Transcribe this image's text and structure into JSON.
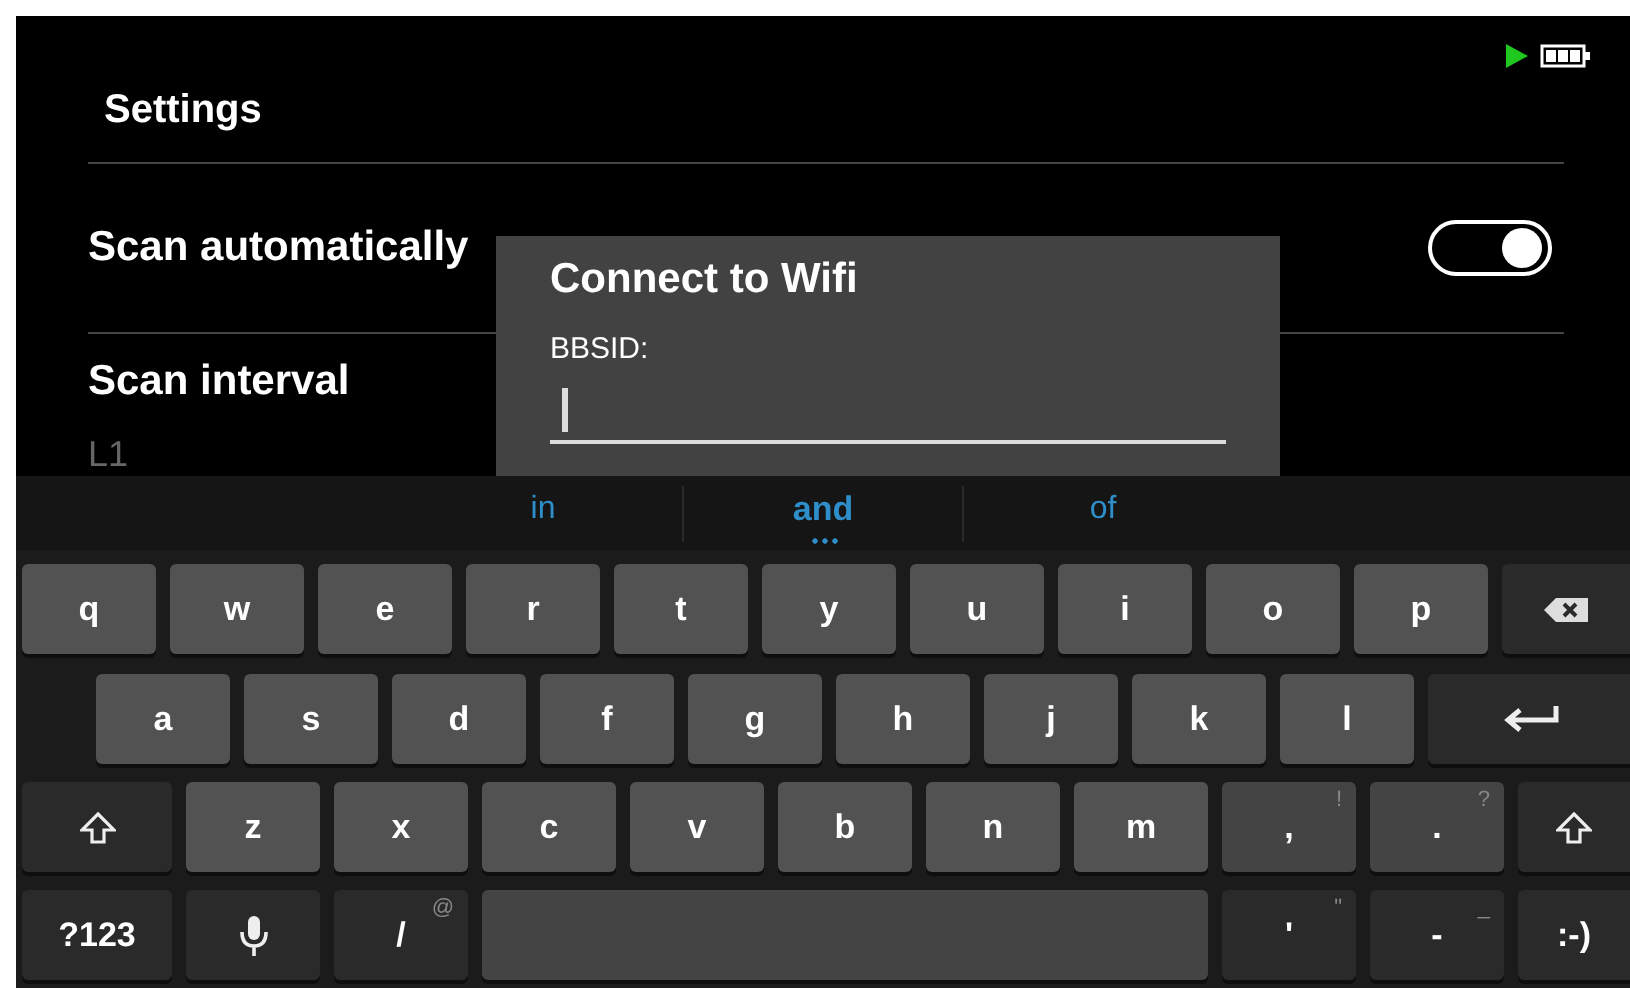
{
  "status_bar": {
    "charging": true
  },
  "header": {
    "title": "Settings"
  },
  "settings": [
    {
      "kind": "toggle",
      "label": "Scan automatically",
      "on": true
    },
    {
      "kind": "value",
      "label": "Scan interval",
      "value": "L1"
    }
  ],
  "dialog": {
    "title": "Connect to Wifi",
    "field_label": "BBSID:",
    "focused": true
  },
  "keyboard": {
    "suggestions": [
      {
        "text": "in",
        "selected": false
      },
      {
        "text": "and",
        "selected": true
      },
      {
        "text": "of",
        "selected": false
      }
    ],
    "rows": [
      [
        {
          "kind": "letter",
          "label": "q"
        },
        {
          "kind": "letter",
          "label": "w"
        },
        {
          "kind": "letter",
          "label": "e"
        },
        {
          "kind": "letter",
          "label": "r"
        },
        {
          "kind": "letter",
          "label": "t"
        },
        {
          "kind": "letter",
          "label": "y"
        },
        {
          "kind": "letter",
          "label": "u"
        },
        {
          "kind": "letter",
          "label": "i"
        },
        {
          "kind": "letter",
          "label": "o"
        },
        {
          "kind": "letter",
          "label": "p"
        },
        {
          "kind": "backspace"
        }
      ],
      [
        {
          "kind": "letter",
          "label": "a"
        },
        {
          "kind": "letter",
          "label": "s"
        },
        {
          "kind": "letter",
          "label": "d"
        },
        {
          "kind": "letter",
          "label": "f"
        },
        {
          "kind": "letter",
          "label": "g"
        },
        {
          "kind": "letter",
          "label": "h"
        },
        {
          "kind": "letter",
          "label": "j"
        },
        {
          "kind": "letter",
          "label": "k"
        },
        {
          "kind": "letter",
          "label": "l"
        },
        {
          "kind": "enter"
        }
      ],
      [
        {
          "kind": "shift"
        },
        {
          "kind": "letter",
          "label": "z"
        },
        {
          "kind": "letter",
          "label": "x"
        },
        {
          "kind": "letter",
          "label": "c"
        },
        {
          "kind": "letter",
          "label": "v"
        },
        {
          "kind": "letter",
          "label": "b"
        },
        {
          "kind": "letter",
          "label": "n"
        },
        {
          "kind": "letter",
          "label": "m"
        },
        {
          "kind": "symbol",
          "label": ",",
          "hint": "!"
        },
        {
          "kind": "symbol",
          "label": ".",
          "hint": "?"
        },
        {
          "kind": "shift"
        }
      ],
      [
        {
          "kind": "function",
          "label": "?123"
        },
        {
          "kind": "mic"
        },
        {
          "kind": "function",
          "label": "/",
          "hint": "@"
        },
        {
          "kind": "space"
        },
        {
          "kind": "function",
          "label": "'",
          "hint": "\""
        },
        {
          "kind": "function",
          "label": "-",
          "hint": "_"
        },
        {
          "kind": "function",
          "label": ":-)"
        }
      ]
    ]
  }
}
